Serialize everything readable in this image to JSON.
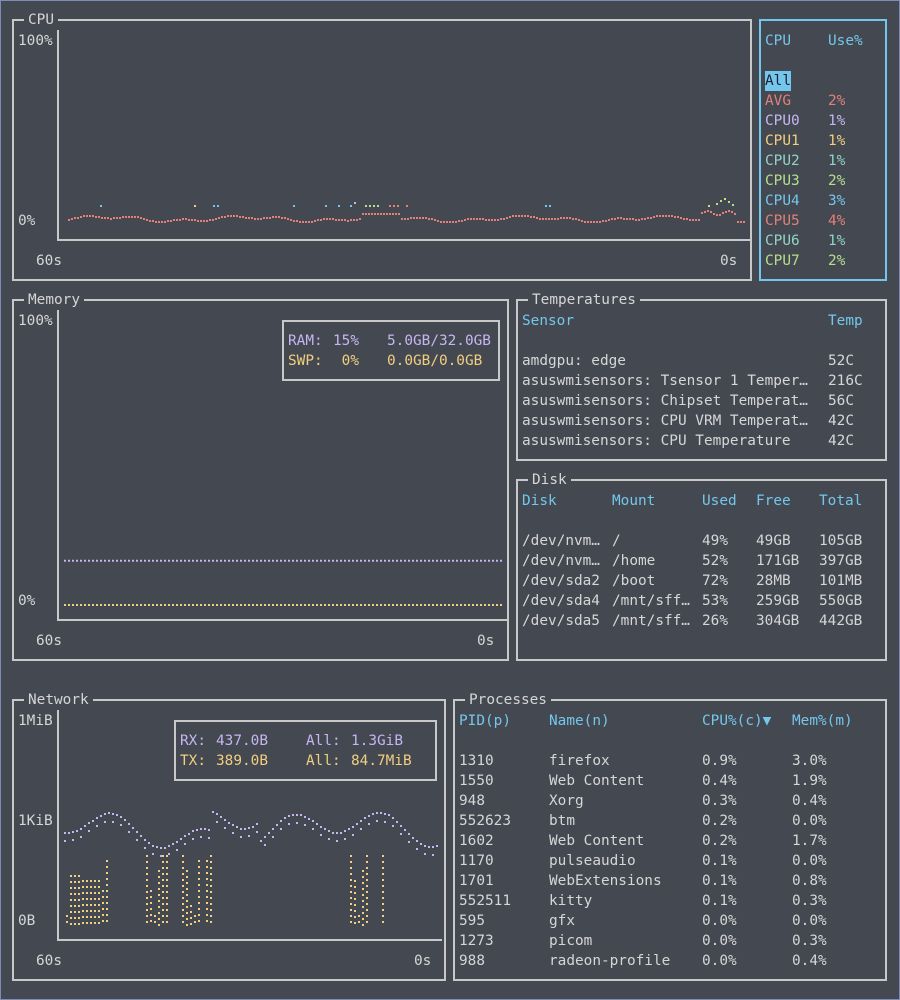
{
  "colors": {
    "background": "#434851",
    "border": "#c8c8c8",
    "header": "#74c7ec",
    "ram": "#c5b6f2",
    "swap": "#f2cf7f",
    "rx": "#c5b6f2",
    "tx": "#f2cf7f",
    "avg": "#e38079"
  },
  "cpu": {
    "title": "CPU",
    "y_top": "100%",
    "y_bottom": "0%",
    "x_left": "60s",
    "x_right": "0s",
    "legend": {
      "header_cpu": "CPU",
      "header_use": "Use%",
      "all_label": "All",
      "rows": [
        {
          "name": "AVG",
          "use": "2%",
          "color": "#e38079"
        },
        {
          "name": "CPU0",
          "use": "1%",
          "color": "#c5b6f2"
        },
        {
          "name": "CPU1",
          "use": "1%",
          "color": "#f2cf7f"
        },
        {
          "name": "CPU2",
          "use": "1%",
          "color": "#8fd5c5"
        },
        {
          "name": "CPU3",
          "use": "2%",
          "color": "#b5e08a"
        },
        {
          "name": "CPU4",
          "use": "3%",
          "color": "#74c7ec"
        },
        {
          "name": "CPU5",
          "use": "4%",
          "color": "#e38079"
        },
        {
          "name": "CPU6",
          "use": "1%",
          "color": "#8fd5c5"
        },
        {
          "name": "CPU7",
          "use": "2%",
          "color": "#b5e08a"
        }
      ]
    }
  },
  "memory": {
    "title": "Memory",
    "y_top": "100%",
    "y_bottom": "0%",
    "x_left": "60s",
    "x_right": "0s",
    "ram_label": "RAM:",
    "ram_pct": "15%",
    "ram_usage": "5.0GB/32.0GB",
    "swp_label": "SWP:",
    "swp_pct": " 0%",
    "swp_usage": "0.0GB/0.0GB",
    "ram_level": 0.15,
    "swp_level": 0.0
  },
  "temperatures": {
    "title": "Temperatures",
    "header_sensor": "Sensor",
    "header_temp": "Temp",
    "rows": [
      {
        "sensor": "amdgpu: edge",
        "temp": "52C"
      },
      {
        "sensor": "asuswmisensors: Tsensor 1 Temper…",
        "temp": "216C"
      },
      {
        "sensor": "asuswmisensors: Chipset Temperat…",
        "temp": "56C"
      },
      {
        "sensor": "asuswmisensors: CPU VRM Temperat…",
        "temp": "42C"
      },
      {
        "sensor": "asuswmisensors: CPU Temperature",
        "temp": "42C"
      }
    ]
  },
  "disk": {
    "title": "Disk",
    "headers": [
      "Disk",
      "Mount",
      "Used",
      "Free",
      "Total"
    ],
    "rows": [
      [
        "/dev/nvm…",
        "/",
        "49%",
        "49GB",
        "105GB"
      ],
      [
        "/dev/nvm…",
        "/home",
        "52%",
        "171GB",
        "397GB"
      ],
      [
        "/dev/sda2",
        "/boot",
        "72%",
        "28MB",
        "101MB"
      ],
      [
        "/dev/sda4",
        "/mnt/sff…",
        "53%",
        "259GB",
        "550GB"
      ],
      [
        "/dev/sda5",
        "/mnt/sff…",
        "26%",
        "304GB",
        "442GB"
      ]
    ]
  },
  "network": {
    "title": "Network",
    "y_top": "1MiB",
    "y_mid": "1KiB",
    "y_bottom": "0B",
    "x_left": "60s",
    "x_right": "0s",
    "rx_label": "RX:",
    "rx_value": "437.0B",
    "rx_all_label": "All:",
    "rx_all": "1.3GiB",
    "tx_label": "TX:",
    "tx_value": "389.0B",
    "tx_all_label": "All:",
    "tx_all": "84.7MiB"
  },
  "processes": {
    "title": "Processes",
    "headers": [
      "PID(p)",
      "Name(n)",
      "CPU%(c)▼",
      "Mem%(m)"
    ],
    "rows": [
      [
        "1310",
        "firefox",
        "0.9%",
        "3.0%"
      ],
      [
        "1550",
        "Web Content",
        "0.4%",
        "1.9%"
      ],
      [
        "948",
        "Xorg",
        "0.3%",
        "0.4%"
      ],
      [
        "552623",
        "btm",
        "0.2%",
        "0.0%"
      ],
      [
        "1602",
        "Web Content",
        "0.2%",
        "1.7%"
      ],
      [
        "1170",
        "pulseaudio",
        "0.1%",
        "0.0%"
      ],
      [
        "1701",
        "WebExtensions",
        "0.1%",
        "0.8%"
      ],
      [
        "552511",
        "kitty",
        "0.1%",
        "0.3%"
      ],
      [
        "595",
        "gfx",
        "0.0%",
        "0.0%"
      ],
      [
        "1273",
        "picom",
        "0.0%",
        "0.3%"
      ],
      [
        "988",
        "radeon-profile",
        "0.0%",
        "0.4%"
      ]
    ]
  }
}
